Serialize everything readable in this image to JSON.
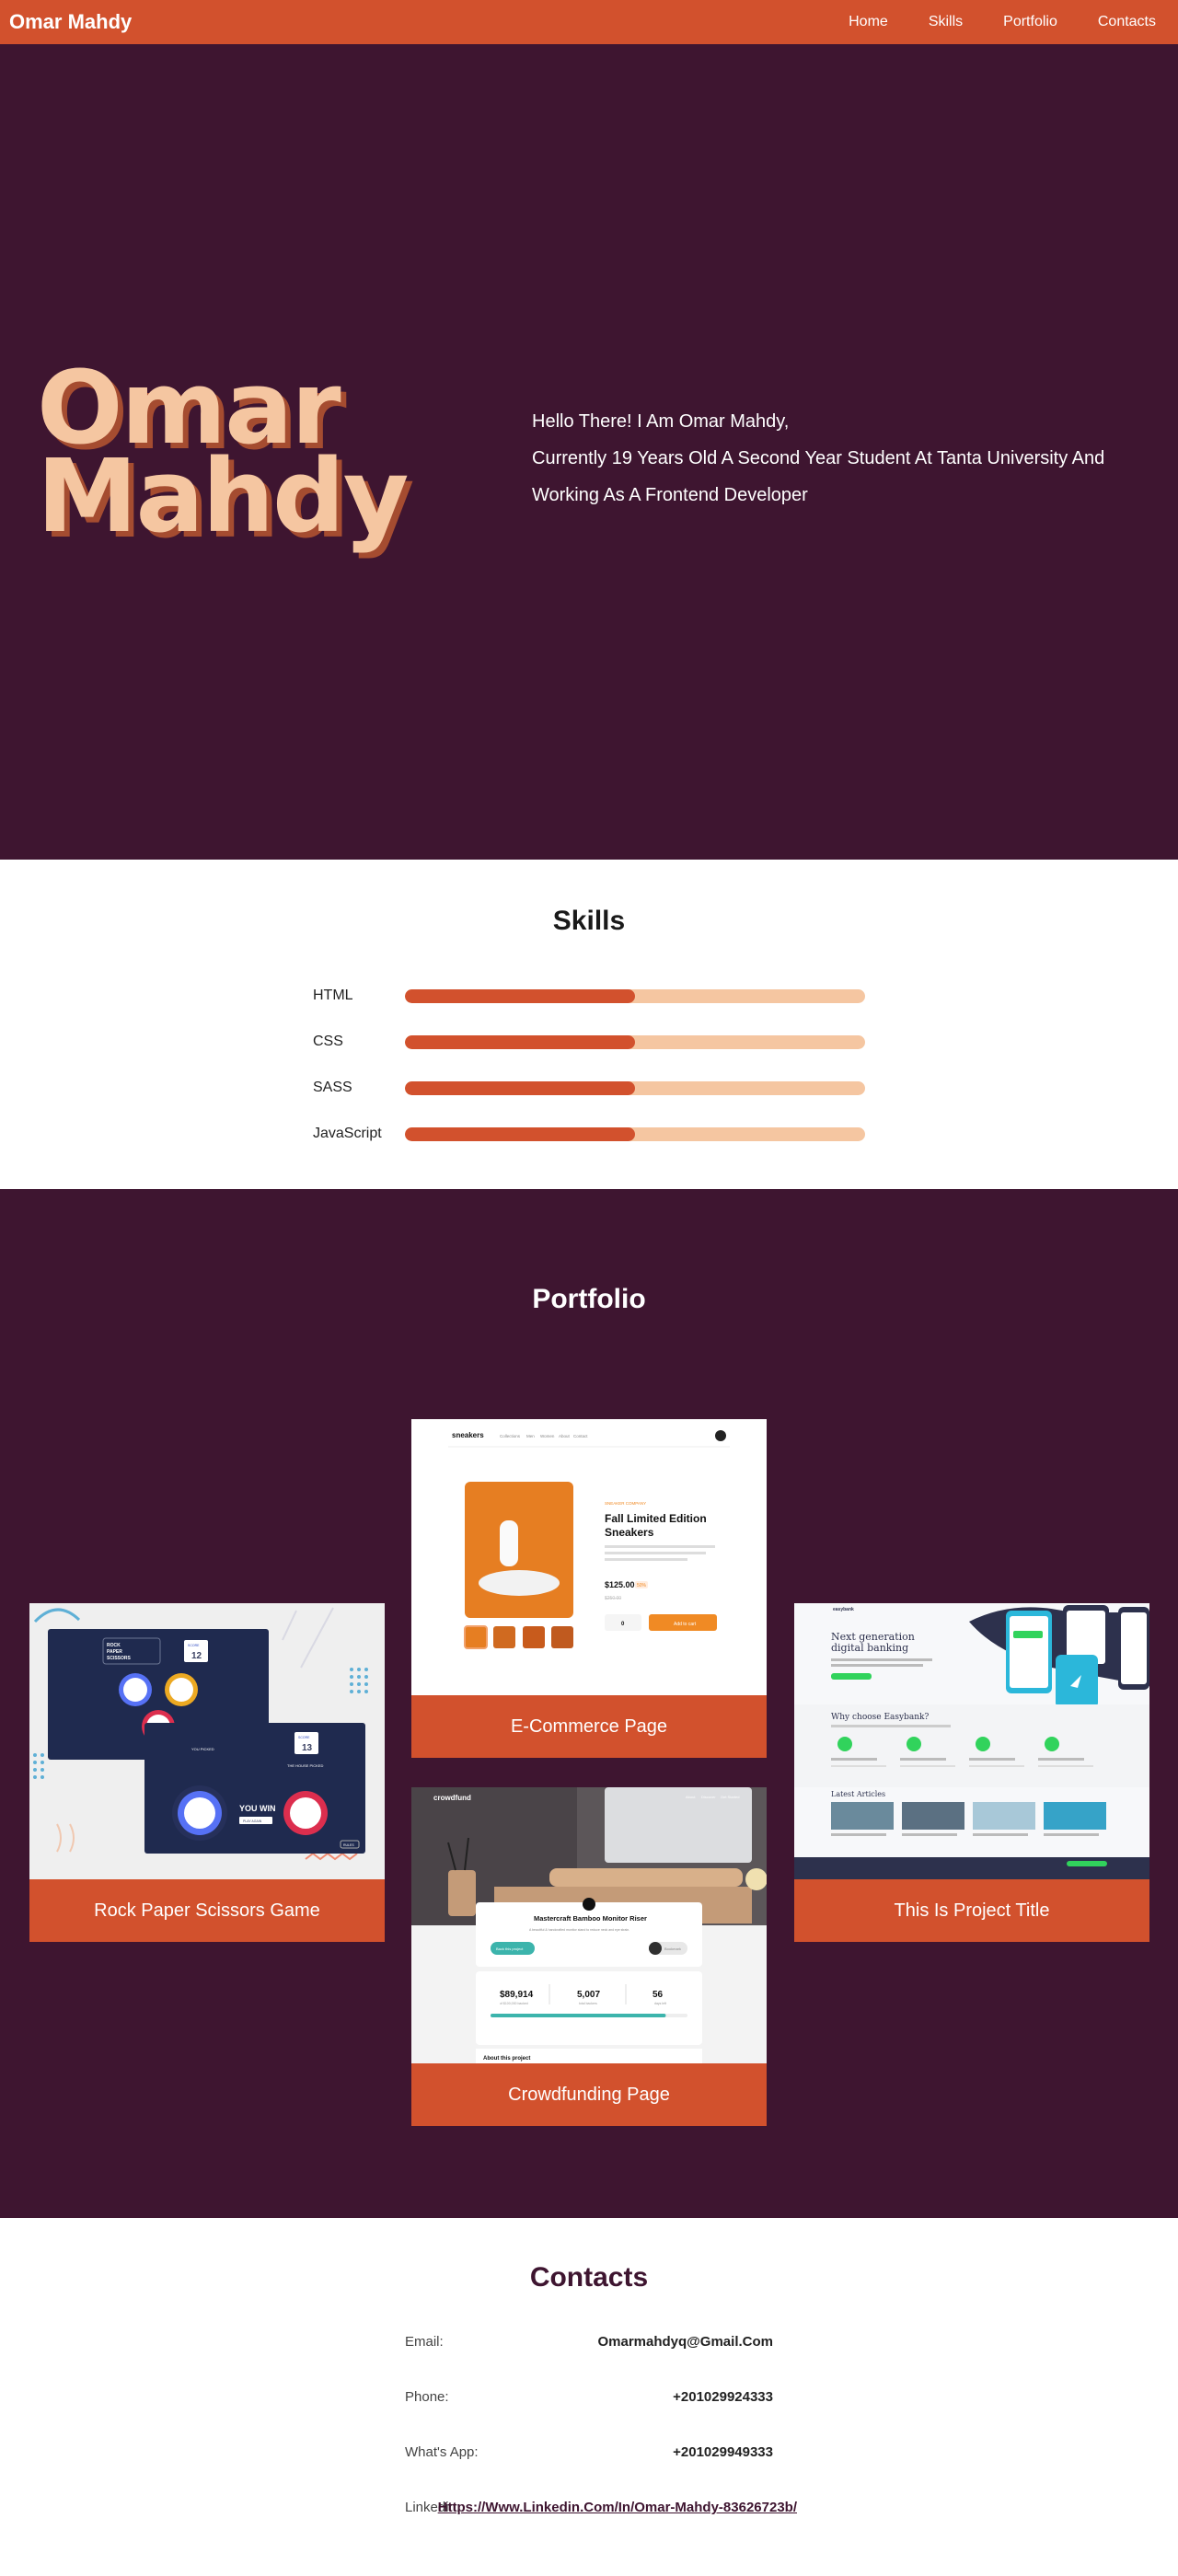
{
  "nav": {
    "brand": "Omar Mahdy",
    "links": [
      "Home",
      "Skills",
      "Portfolio",
      "Contacts"
    ]
  },
  "hero": {
    "name_line1": "Omar",
    "name_line2": "Mahdy",
    "line1": "Hello There! I Am Omar Mahdy,",
    "line2": "Currently 19 Years Old A Second Year Student At Tanta University And",
    "line3": "Working As A Frontend Developer"
  },
  "skills": {
    "title": "Skills",
    "items": [
      {
        "label": "HTML",
        "level": 0.5
      },
      {
        "label": "CSS",
        "level": 0.5
      },
      {
        "label": "SASS",
        "level": 0.5
      },
      {
        "label": "JavaScript",
        "level": 0.5
      }
    ]
  },
  "portfolio": {
    "title": "Portfolio",
    "projects": [
      {
        "caption": "E-Commerce Page"
      },
      {
        "caption": "Rock Paper Scissors Game"
      },
      {
        "caption": "This Is Project Title"
      },
      {
        "caption": "Crowdfunding Page"
      }
    ],
    "ecom": {
      "brand": "sneakers",
      "nav": [
        "Collections",
        "Men",
        "Women",
        "About",
        "Contact"
      ],
      "company": "SNEAKER COMPANY",
      "product": "Fall Limited Edition Sneakers",
      "price": "$125.00",
      "discount": "50%",
      "old_price": "$250.00",
      "qty": "0",
      "cart": "Add to cart"
    },
    "rps": {
      "title": "ROCK PAPER SCISSORS",
      "score_label": "SCORE",
      "score1": "12",
      "score2": "13",
      "you_picked": "YOU PICKED",
      "house_picked": "THE HOUSE PICKED",
      "result": "YOU WIN",
      "play_again": "PLAY AGAIN",
      "rules": "RULES"
    },
    "crowd": {
      "brand": "crowdfund",
      "nav": [
        "About",
        "Discover",
        "Get Started"
      ],
      "product": "Mastercraft Bamboo Monitor Riser",
      "subtitle": "A beautiful & handcrafted monitor stand to reduce neck and eye strain.",
      "back_btn": "Back this project",
      "bookmark": "Bookmark",
      "stat1": "$89,914",
      "stat1_sub": "of $100,000 backed",
      "stat2": "5,007",
      "stat2_sub": "total backers",
      "stat3": "56",
      "stat3_sub": "days left",
      "about": "About this project",
      "progress": 0.89
    },
    "bank": {
      "brand": "easybank",
      "hero_title": "Next generation digital banking",
      "why": "Why choose Easybank?",
      "latest": "Latest Articles"
    }
  },
  "contacts": {
    "title": "Contacts",
    "rows": [
      {
        "label": "Email:",
        "value": "Omarmahdyq@Gmail.Com"
      },
      {
        "label": "Phone:",
        "value": "+201029924333"
      },
      {
        "label": "What's App:",
        "value": "+201029949333"
      },
      {
        "label": "Linkedin:",
        "value": "Https://Www.Linkedin.Com/In/Omar-Mahdy-83626723b/"
      }
    ]
  }
}
